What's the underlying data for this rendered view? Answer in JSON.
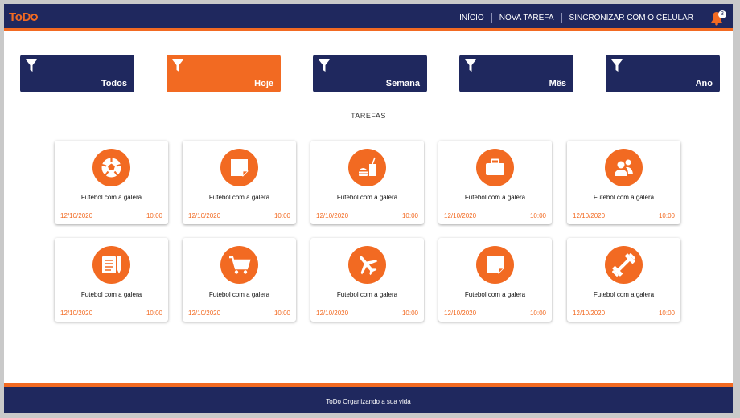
{
  "app": {
    "logo": "ToDo",
    "logo_text_a": "ToD"
  },
  "nav": {
    "items": [
      "INÍCIO",
      "NOVA TAREFA",
      "SINCRONIZAR COM O CELULAR"
    ],
    "notification_count": "3"
  },
  "filters": [
    {
      "label": "Todos",
      "active": false
    },
    {
      "label": "Hoje",
      "active": true
    },
    {
      "label": "Semana",
      "active": false
    },
    {
      "label": "Mês",
      "active": false
    },
    {
      "label": "Ano",
      "active": false
    }
  ],
  "section_title": "TAREFAS",
  "tasks": [
    {
      "icon": "soccer-ball-icon",
      "title": "Futebol com a galera",
      "date": "12/10/2020",
      "time": "10:00"
    },
    {
      "icon": "note-icon",
      "title": "Futebol com a galera",
      "date": "12/10/2020",
      "time": "10:00"
    },
    {
      "icon": "fast-food-icon",
      "title": "Futebol com a galera",
      "date": "12/10/2020",
      "time": "10:00"
    },
    {
      "icon": "briefcase-icon",
      "title": "Futebol com a galera",
      "date": "12/10/2020",
      "time": "10:00"
    },
    {
      "icon": "people-icon",
      "title": "Futebol com a galera",
      "date": "12/10/2020",
      "time": "10:00"
    },
    {
      "icon": "document-pencil-icon",
      "title": "Futebol com a galera",
      "date": "12/10/2020",
      "time": "10:00"
    },
    {
      "icon": "shopping-cart-icon",
      "title": "Futebol com a galera",
      "date": "12/10/2020",
      "time": "10:00"
    },
    {
      "icon": "airplane-icon",
      "title": "Futebol com a galera",
      "date": "12/10/2020",
      "time": "10:00"
    },
    {
      "icon": "note-icon",
      "title": "Futebol com a galera",
      "date": "12/10/2020",
      "time": "10:00"
    },
    {
      "icon": "dumbbell-icon",
      "title": "Futebol com a galera",
      "date": "12/10/2020",
      "time": "10:00"
    }
  ],
  "footer": {
    "text": "ToDo Organizando a sua vida"
  },
  "colors": {
    "navy": "#1f285e",
    "orange": "#f26a22"
  }
}
